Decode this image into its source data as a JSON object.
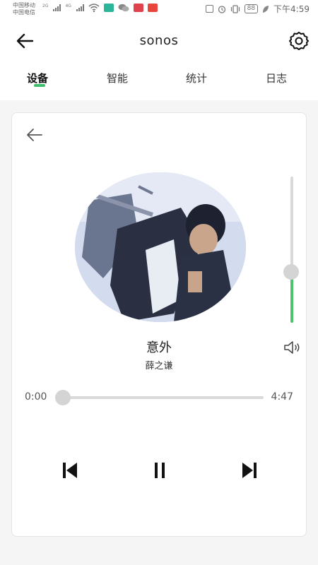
{
  "status_bar": {
    "carrier1": "中国移动",
    "carrier2": "中国电信",
    "net1": "2G",
    "net2": "4G",
    "battery": "88",
    "time": "下午4:59"
  },
  "header": {
    "title": "sonos"
  },
  "tabs": [
    {
      "label": "设备",
      "active": true
    },
    {
      "label": "智能",
      "active": false
    },
    {
      "label": "统计",
      "active": false
    },
    {
      "label": "日志",
      "active": false
    }
  ],
  "player": {
    "song_title": "意外",
    "artist": "薛之谦",
    "current_time": "0:00",
    "total_time": "4:47",
    "progress_fraction": 0.0,
    "volume_fraction": 0.35
  },
  "colors": {
    "accent": "#3fbf6d"
  }
}
